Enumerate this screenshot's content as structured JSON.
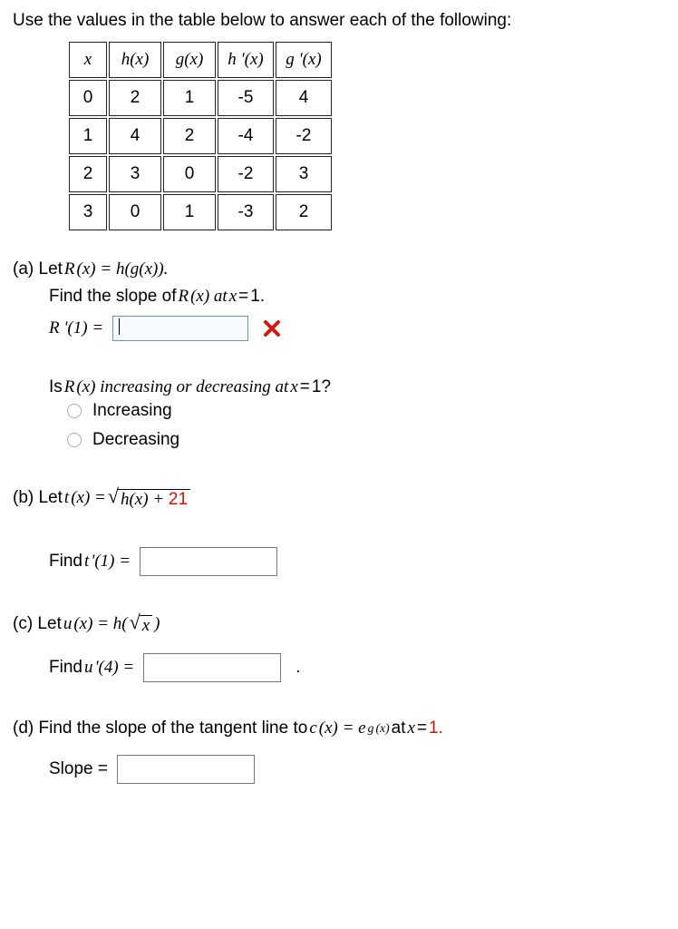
{
  "instruction": "Use the values in the table below to answer each of the following:",
  "table": {
    "headers": [
      "x",
      "h(x)",
      "g(x)",
      "h '(x)",
      "g '(x)"
    ],
    "rows": [
      [
        "0",
        "2",
        "1",
        "-5",
        "4"
      ],
      [
        "1",
        "4",
        "2",
        "-4",
        "-2"
      ],
      [
        "2",
        "3",
        "0",
        "-2",
        "3"
      ],
      [
        "3",
        "0",
        "1",
        "-3",
        "2"
      ]
    ]
  },
  "partA": {
    "label": "(a) Let ",
    "def_pre": "R",
    "def_mid": "(x) = h(g(x)).",
    "prompt1_pre": "Find the slope of ",
    "prompt1_r": "R",
    "prompt1_mid": "(x) at ",
    "prompt1_x": "x",
    "prompt1_eq": " = ",
    "prompt1_val": "1.",
    "lhs": "R '(1) = ",
    "input_value": "",
    "q2_pre": "Is ",
    "q2_r": "R",
    "q2_mid": "(x) increasing or decreasing at ",
    "q2_x": "x",
    "q2_eq": " = ",
    "q2_val": "1?",
    "opt1": "Increasing",
    "opt2": "Decreasing"
  },
  "partB": {
    "label": "(b) Let  ",
    "t": "t",
    "defmid": "(x) = ",
    "radicand_pre": "h(x) + ",
    "radicand_num": "21",
    "prompt_pre": "Find ",
    "prompt_t": "t ",
    "prompt_rest": "'(1) = "
  },
  "partC": {
    "label": "(c) Let  ",
    "u": "u",
    "defmid": "(x) = h(",
    "radicand": "x",
    "defend": ")",
    "prompt_pre": "Find ",
    "prompt_u": "u ",
    "prompt_rest": "'(4) = ",
    "period": "."
  },
  "partD": {
    "label_pre": "(d) Find the slope of the tangent line to  ",
    "c": "c",
    "mid": "(x) = e",
    "exp_g": "g",
    "exp_rest": "(x)",
    "post1": "  at ",
    "x": "x",
    "eq": " = ",
    "val": "1.",
    "slope": "Slope = "
  }
}
